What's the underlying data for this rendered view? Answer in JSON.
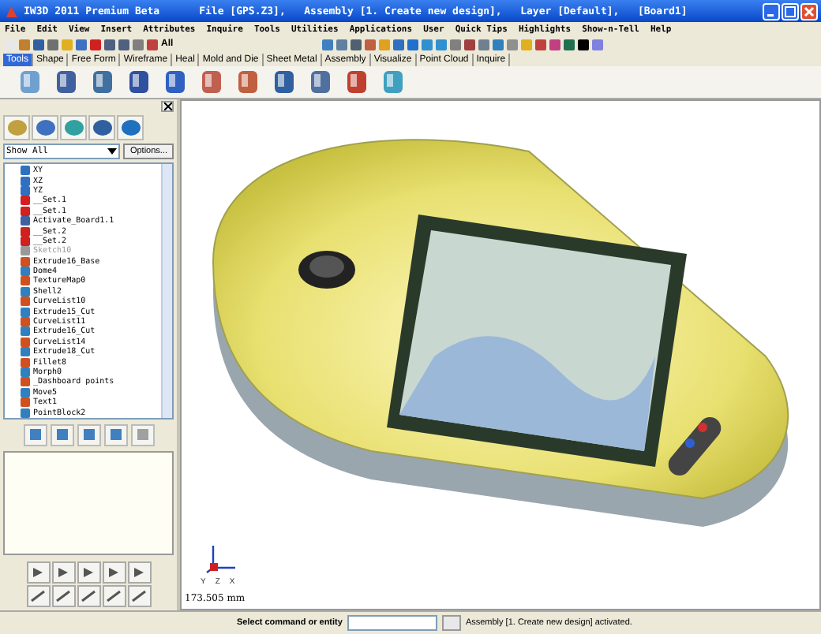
{
  "window": {
    "title": "IW3D 2011 Premium Beta",
    "document": "File [GPS.Z3],   Assembly [1. Create new design],   Layer [Default],   [Board1]"
  },
  "menu": [
    "File",
    "Edit",
    "View",
    "Insert",
    "Attributes",
    "Inquire",
    "Tools",
    "Utilities",
    "Applications",
    "User",
    "Quick Tips",
    "Highlights",
    "Show-n-Tell",
    "Help"
  ],
  "toolbar": {
    "filter_label": "All"
  },
  "ribbon_tabs": [
    {
      "label": "Tools",
      "selected": true
    },
    {
      "label": "Shape",
      "selected": false
    },
    {
      "label": "Free Form",
      "selected": false
    },
    {
      "label": "Wireframe",
      "selected": false
    },
    {
      "label": "Heal",
      "selected": false
    },
    {
      "label": "Mold and Die",
      "selected": false
    },
    {
      "label": "Sheet Metal",
      "selected": false
    },
    {
      "label": "Assembly",
      "selected": false
    },
    {
      "label": "Visualize",
      "selected": false
    },
    {
      "label": "Point Cloud",
      "selected": false
    },
    {
      "label": "Inquire",
      "selected": false
    }
  ],
  "sidebar": {
    "filter": "Show All",
    "options_button": "Options...",
    "tree": [
      {
        "label": "XY",
        "disabled": false
      },
      {
        "label": "XZ",
        "disabled": false
      },
      {
        "label": "YZ",
        "disabled": false
      },
      {
        "label": "__Set.1",
        "disabled": false
      },
      {
        "label": "__Set.1",
        "disabled": false
      },
      {
        "label": "Activate_Board1.1",
        "disabled": false
      },
      {
        "label": "__Set.2",
        "disabled": false
      },
      {
        "label": "__Set.2",
        "disabled": false
      },
      {
        "label": "Sketch10",
        "disabled": true
      },
      {
        "label": "Extrude16_Base",
        "disabled": false
      },
      {
        "label": "Dome4",
        "disabled": false
      },
      {
        "label": "TextureMap0",
        "disabled": false
      },
      {
        "label": "Shell2",
        "disabled": false
      },
      {
        "label": "CurveList10",
        "disabled": false
      },
      {
        "label": "Extrude15_Cut",
        "disabled": false
      },
      {
        "label": "CurveList11",
        "disabled": false
      },
      {
        "label": "Extrude16_Cut",
        "disabled": false
      },
      {
        "label": "CurveList14",
        "disabled": false
      },
      {
        "label": "Extrude18_Cut",
        "disabled": false
      },
      {
        "label": "Fillet8",
        "disabled": false
      },
      {
        "label": "Morph0",
        "disabled": false
      },
      {
        "label": "_Dashboard points",
        "disabled": false
      },
      {
        "label": "Move5",
        "disabled": false
      },
      {
        "label": "Text1",
        "disabled": false
      },
      {
        "label": "PointBlock2",
        "disabled": false
      }
    ]
  },
  "viewport": {
    "scale": "173.505 mm",
    "axis_labels": [
      "Y",
      "Z",
      "X"
    ]
  },
  "status_bar": {
    "prompt": "Select command or entity",
    "message": "Assembly [1. Create new design] activated."
  }
}
